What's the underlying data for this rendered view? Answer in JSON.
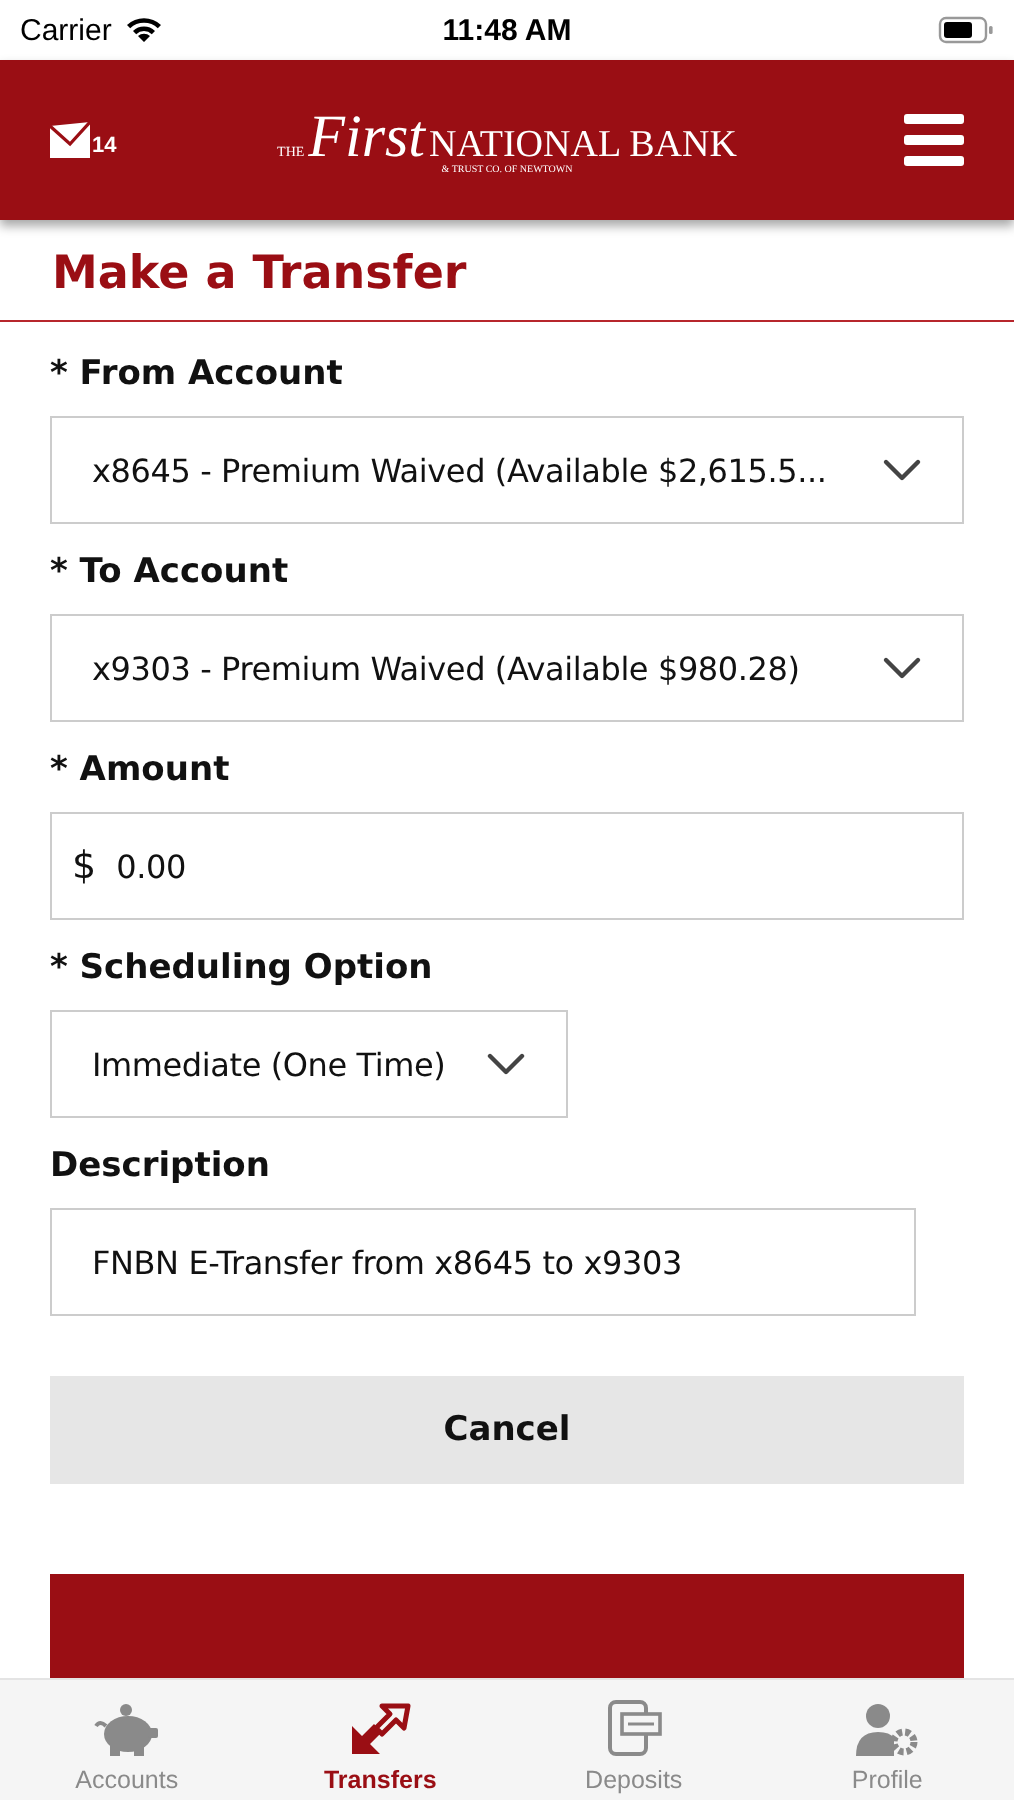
{
  "status_bar": {
    "carrier": "Carrier",
    "time": "11:48 AM"
  },
  "header": {
    "message_count": "14",
    "logo": {
      "prefix": "THE",
      "script": "First",
      "name": "NATIONAL BANK",
      "tagline": "& TRUST CO. OF NEWTOWN"
    }
  },
  "page_title": "Make a Transfer",
  "form": [
    {
      "kind": "select",
      "label": "* From Account",
      "value": "x8645 - Premium Waived (Available $2,615.5..."
    },
    {
      "kind": "select",
      "label": "* To Account",
      "value": "x9303 - Premium Waived (Available $980.28)"
    },
    {
      "kind": "amount",
      "label": "* Amount",
      "prefix": "$",
      "value": "0.00"
    },
    {
      "kind": "select",
      "label": "* Scheduling Option",
      "value": "Immediate (One Time)"
    },
    {
      "kind": "text",
      "label": "Description",
      "value": "FNBN E-Transfer from x8645 to x9303"
    }
  ],
  "buttons": [
    {
      "kind": "secondary",
      "label": "Cancel"
    },
    {
      "kind": "primary"
    }
  ],
  "tab_bar": [
    {
      "label": "Accounts",
      "selected": false
    },
    {
      "label": "Transfers",
      "selected": true
    },
    {
      "label": "Deposits",
      "selected": false
    },
    {
      "label": "Profile",
      "selected": false
    }
  ]
}
